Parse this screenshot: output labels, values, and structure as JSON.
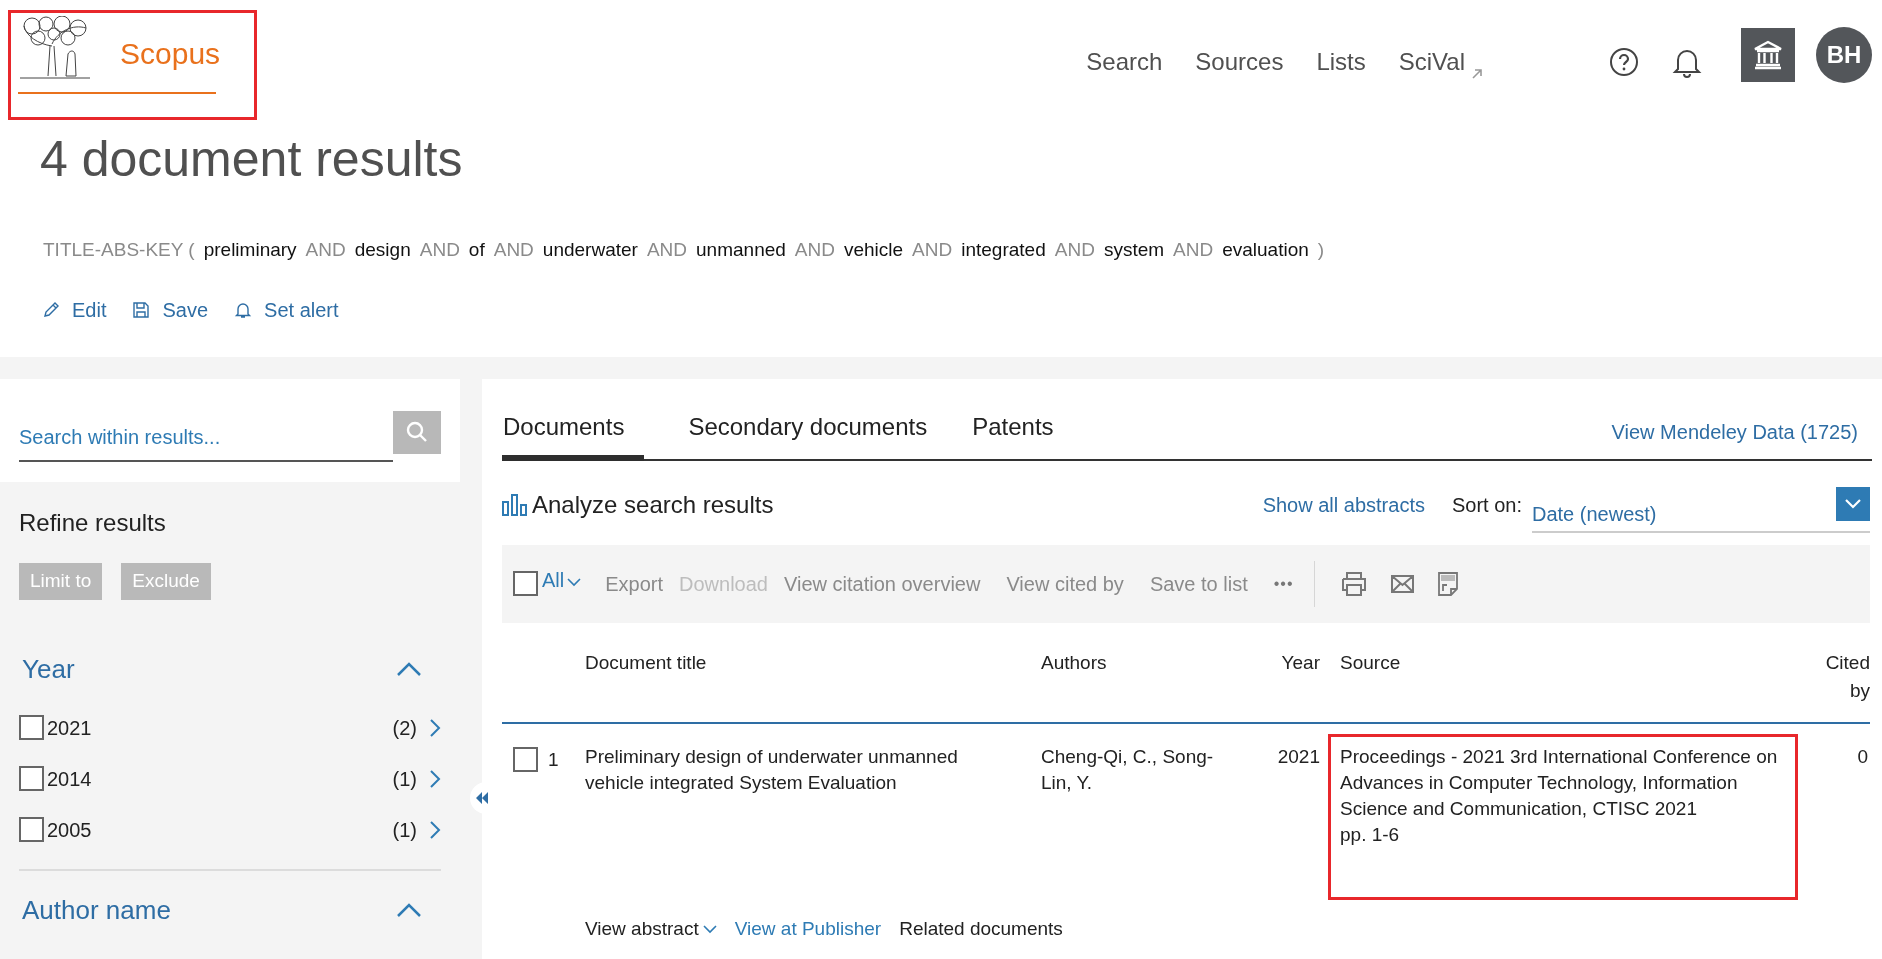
{
  "header": {
    "logo": {
      "text": "Scopus",
      "highlighted": true
    },
    "nav": [
      {
        "label": "Search",
        "external": false
      },
      {
        "label": "Sources",
        "external": false
      },
      {
        "label": "Lists",
        "external": false
      },
      {
        "label": "SciVal",
        "external": true
      }
    ],
    "avatar": "BH"
  },
  "results_title": "4 document results",
  "query": [
    {
      "text": "TITLE-ABS-KEY (",
      "kind": "syntax"
    },
    {
      "text": "preliminary",
      "kind": "term"
    },
    {
      "text": "AND",
      "kind": "syntax"
    },
    {
      "text": "design",
      "kind": "term"
    },
    {
      "text": "AND",
      "kind": "syntax"
    },
    {
      "text": "of",
      "kind": "term"
    },
    {
      "text": "AND",
      "kind": "syntax"
    },
    {
      "text": "underwater",
      "kind": "term"
    },
    {
      "text": "AND",
      "kind": "syntax"
    },
    {
      "text": "unmanned",
      "kind": "term"
    },
    {
      "text": "AND",
      "kind": "syntax"
    },
    {
      "text": "vehicle",
      "kind": "term"
    },
    {
      "text": "AND",
      "kind": "syntax"
    },
    {
      "text": "integrated",
      "kind": "term"
    },
    {
      "text": "AND",
      "kind": "syntax"
    },
    {
      "text": "system",
      "kind": "term"
    },
    {
      "text": "AND",
      "kind": "syntax"
    },
    {
      "text": "evaluation",
      "kind": "term"
    },
    {
      "text": ")",
      "kind": "syntax"
    }
  ],
  "query_actions": [
    {
      "label": "Edit",
      "kind": "edit"
    },
    {
      "label": "Save",
      "kind": "save"
    },
    {
      "label": "Set alert",
      "kind": "alert"
    }
  ],
  "sidebar": {
    "search": {
      "placeholder": "Search within results..."
    },
    "refine_title": "Refine results",
    "buttons": [
      "Limit to",
      "Exclude"
    ],
    "facets": [
      {
        "title": "Year",
        "expanded": true,
        "items": [
          {
            "label": "2021",
            "count": "(2)",
            "checked": false
          },
          {
            "label": "2014",
            "count": "(1)",
            "checked": false
          },
          {
            "label": "2005",
            "count": "(1)",
            "checked": false
          }
        ]
      },
      {
        "title": "Author name",
        "expanded": true
      }
    ]
  },
  "tabs": [
    {
      "label": "Documents",
      "selected": true
    },
    {
      "label": "Secondary documents",
      "selected": false
    },
    {
      "label": "Patents",
      "selected": false
    }
  ],
  "mendeley_link": "View Mendeley Data (1725)",
  "analyze": "Analyze search results",
  "show_all_abstracts": "Show all abstracts",
  "sort": {
    "label": "Sort on:",
    "value": "Date (newest)"
  },
  "toolbar": {
    "select_all": {
      "label": "All",
      "checked": false
    },
    "actions": [
      {
        "label": "Export",
        "disabled": false
      },
      {
        "label": "Download",
        "disabled": true
      },
      {
        "label": "View citation overview",
        "disabled": false
      },
      {
        "label": "View cited by",
        "disabled": false
      },
      {
        "label": "Save to list",
        "disabled": false
      }
    ],
    "more": "•••"
  },
  "table": {
    "columns": [
      "Document title",
      "Authors",
      "Year",
      "Source",
      "Cited by"
    ],
    "rows": [
      {
        "checked": false,
        "number": "1",
        "title": "Preliminary design of underwater unmanned vehicle integrated System Evaluation",
        "authors": "Cheng-Qi, C., Song-Lin, Y.",
        "year": "2021",
        "source": "Proceedings - 2021 3rd International Conference on Advances in Computer Technology, Information Science and Communication, CTISC 2021",
        "pages": "pp. 1-6",
        "source_highlighted": true,
        "cited_by": "0",
        "links": [
          {
            "label": "View abstract",
            "kind": "toggle"
          },
          {
            "label": "View at Publisher",
            "kind": "link"
          },
          {
            "label": "Related documents",
            "kind": "plain"
          }
        ]
      }
    ]
  }
}
